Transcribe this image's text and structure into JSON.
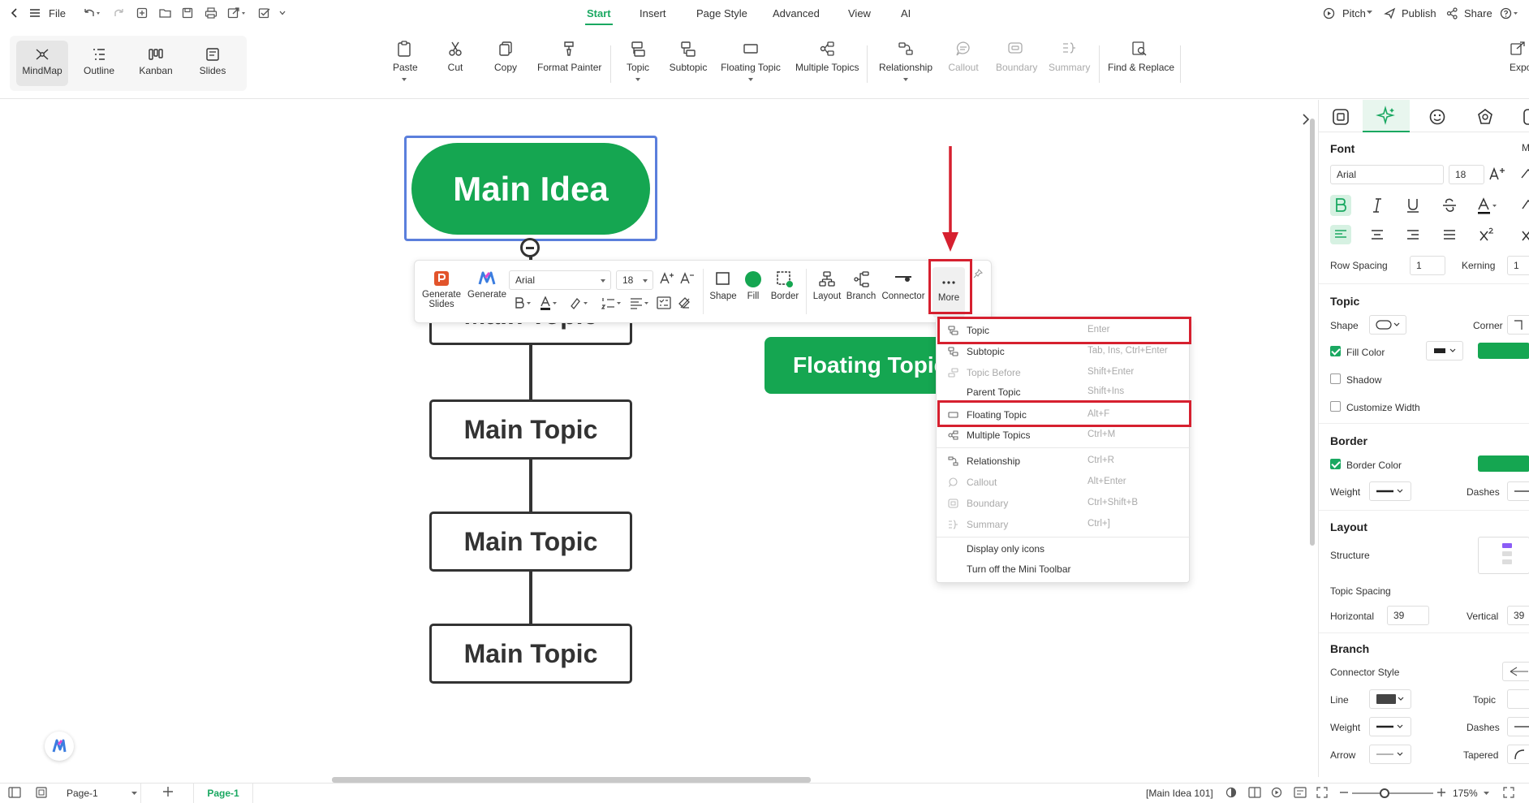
{
  "menubar": {
    "file_label": "File",
    "tabs": [
      "Start",
      "Insert",
      "Page Style",
      "Advanced",
      "View",
      "AI"
    ],
    "active_tab": "Start",
    "right": {
      "pitch": "Pitch",
      "publish": "Publish",
      "share": "Share"
    }
  },
  "ribbon": {
    "views": [
      "MindMap",
      "Outline",
      "Kanban",
      "Slides"
    ],
    "buttons": {
      "paste": "Paste",
      "cut": "Cut",
      "copy": "Copy",
      "format_painter": "Format Painter",
      "topic": "Topic",
      "subtopic": "Subtopic",
      "floating_topic": "Floating Topic",
      "multiple_topics": "Multiple Topics",
      "relationship": "Relationship",
      "callout": "Callout",
      "boundary": "Boundary",
      "summary": "Summary",
      "find_replace": "Find & Replace",
      "export": "Expo"
    }
  },
  "canvas": {
    "main_idea": "Main Idea",
    "topics": [
      "Main Topic",
      "Main Topic",
      "Main Topic",
      "Main Topic"
    ],
    "floating_topic": "Floating Topic"
  },
  "mini_toolbar": {
    "generate_slides": "Generate\nSlides",
    "generate": "Generate",
    "font": "Arial",
    "size": "18",
    "shape": "Shape",
    "fill": "Fill",
    "border": "Border",
    "layout": "Layout",
    "branch": "Branch",
    "connector": "Connector",
    "more": "More"
  },
  "context_menu": {
    "items": [
      {
        "label": "Topic",
        "shortcut": "Enter",
        "disabled": false
      },
      {
        "label": "Subtopic",
        "shortcut": "Tab, Ins, Ctrl+Enter",
        "disabled": false
      },
      {
        "label": "Topic Before",
        "shortcut": "Shift+Enter",
        "disabled": true
      },
      {
        "label": "Parent Topic",
        "shortcut": "Shift+Ins",
        "disabled": false
      },
      {
        "label": "Floating Topic",
        "shortcut": "Alt+F",
        "disabled": false
      },
      {
        "label": "Multiple Topics",
        "shortcut": "Ctrl+M",
        "disabled": false
      },
      {
        "label": "Relationship",
        "shortcut": "Ctrl+R",
        "disabled": false
      },
      {
        "label": "Callout",
        "shortcut": "Alt+Enter",
        "disabled": true
      },
      {
        "label": "Boundary",
        "shortcut": "Ctrl+Shift+B",
        "disabled": true
      },
      {
        "label": "Summary",
        "shortcut": "Ctrl+]",
        "disabled": true
      }
    ],
    "extra": [
      "Display only icons",
      "Turn off the Mini Toolbar"
    ]
  },
  "panel": {
    "font_title": "Font",
    "font_family": "Arial",
    "font_size": "18",
    "row_spacing_label": "Row Spacing",
    "row_spacing": "1",
    "kerning_label": "Kerning",
    "kerning": "1",
    "topic_title": "Topic",
    "shape_label": "Shape",
    "corner_label": "Corner",
    "fill_color_label": "Fill Color",
    "shadow_label": "Shadow",
    "customize_width_label": "Customize Width",
    "border_title": "Border",
    "border_color_label": "Border Color",
    "weight_label": "Weight",
    "dashes_label": "Dashes",
    "layout_title": "Layout",
    "structure_label": "Structure",
    "topic_spacing_label": "Topic Spacing",
    "horizontal_label": "Horizontal",
    "horizontal": "39",
    "vertical_label": "Vertical",
    "vertical": "39",
    "branch_title": "Branch",
    "connector_style_label": "Connector Style",
    "line_label": "Line",
    "topic_label": "Topic",
    "weight2_label": "Weight",
    "dashes2_label": "Dashes",
    "arrow_label": "Arrow",
    "tapered_label": "Tapered",
    "accent": "#1aa861",
    "fill_color": "#15a651"
  },
  "statusbar": {
    "page_select": "Page-1",
    "page_tab": "Page-1",
    "selection": "[Main Idea 101]",
    "zoom": "175%"
  },
  "colors": {
    "green": "#15a651",
    "accent": "#1aa861",
    "highlight_red": "#d6202f",
    "selection_blue": "#5b7fdc"
  }
}
